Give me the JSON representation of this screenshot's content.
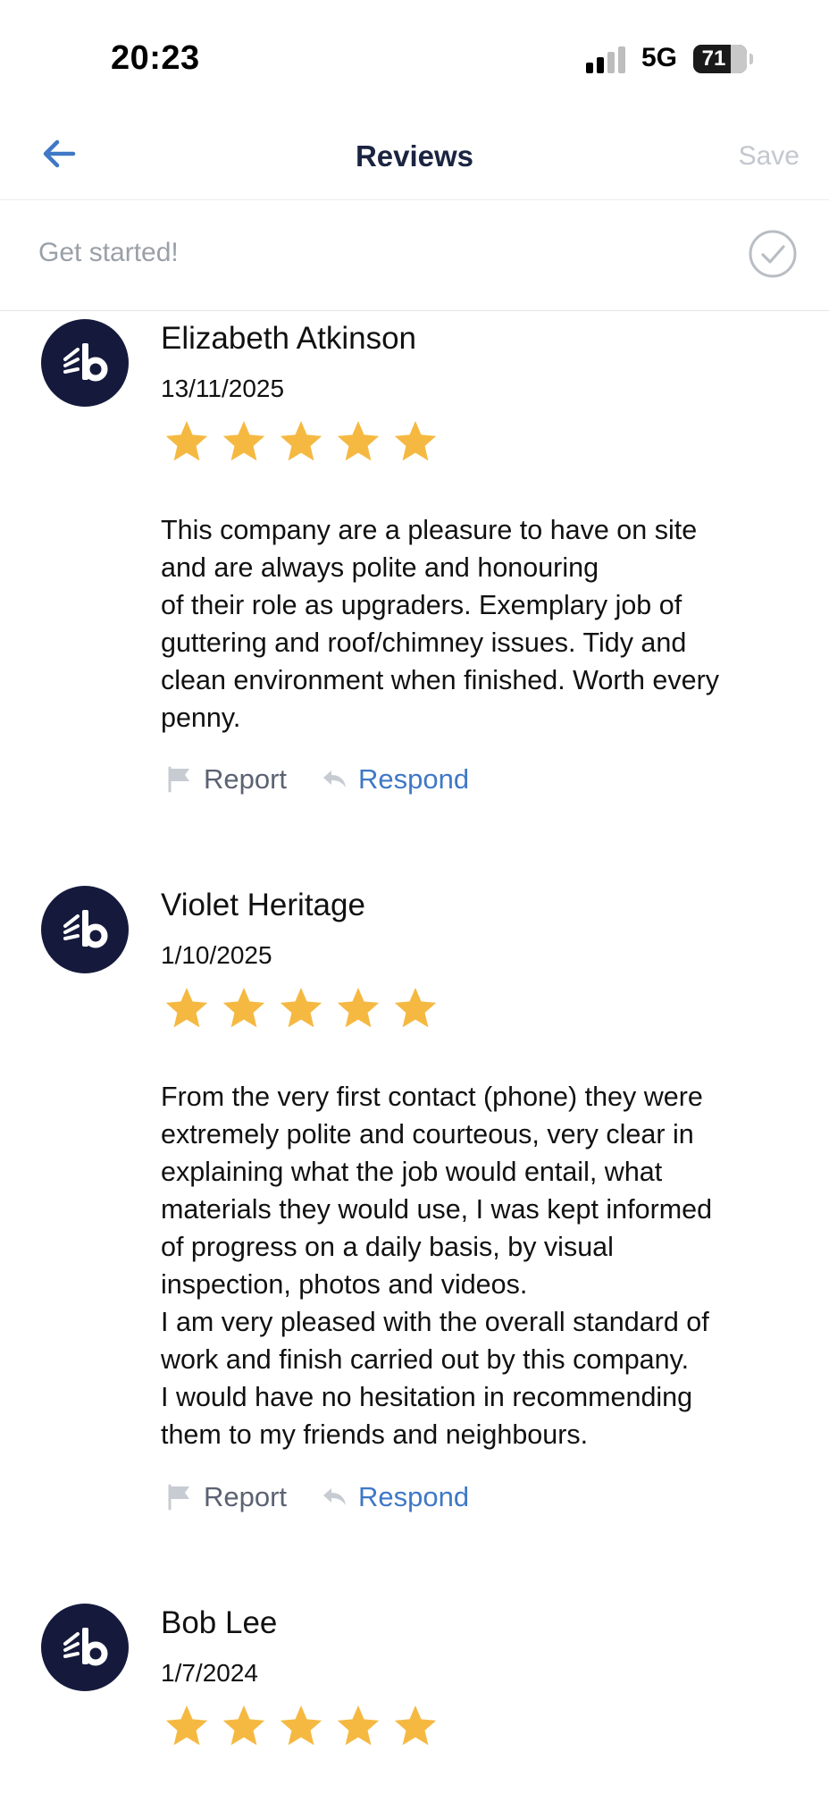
{
  "status_bar": {
    "time": "20:23",
    "network": "5G",
    "battery": "71"
  },
  "nav": {
    "back_icon": "arrow-left-icon",
    "title": "Reviews",
    "save_label": "Save"
  },
  "get_started": {
    "label": "Get started!",
    "icon": "check-circle-icon"
  },
  "reviews": [
    {
      "name": "Elizabeth Atkinson",
      "date": "13/11/2025",
      "rating": 5,
      "text": "This company are a pleasure to have on site\nand are always polite and honouring\nof their role as upgraders.  Exemplary job of\nguttering and roof/chimney issues.  Tidy and\nclean environment when finished.  Worth every\npenny.",
      "report_label": "Report",
      "respond_label": "Respond"
    },
    {
      "name": "Violet Heritage",
      "date": "1/10/2025",
      "rating": 5,
      "text": "From the very first contact (phone)  they were\nextremely polite and courteous,  very clear in\nexplaining what the job would entail,  what\nmaterials they would use, I was kept informed\nof progress on a daily basis,  by visual\ninspection,  photos and videos.\nI am very pleased with the overall standard of\nwork and finish carried out by this company.\nI would have no hesitation in recommending\nthem to my friends and neighbours.",
      "report_label": "Report",
      "respond_label": "Respond"
    },
    {
      "name": "Bob Lee",
      "date": "1/7/2024",
      "rating": 5
    }
  ],
  "colors": {
    "star": "#f5b942",
    "accent": "#3f78c6",
    "avatar_bg": "#151a3d",
    "title": "#1b2440"
  }
}
